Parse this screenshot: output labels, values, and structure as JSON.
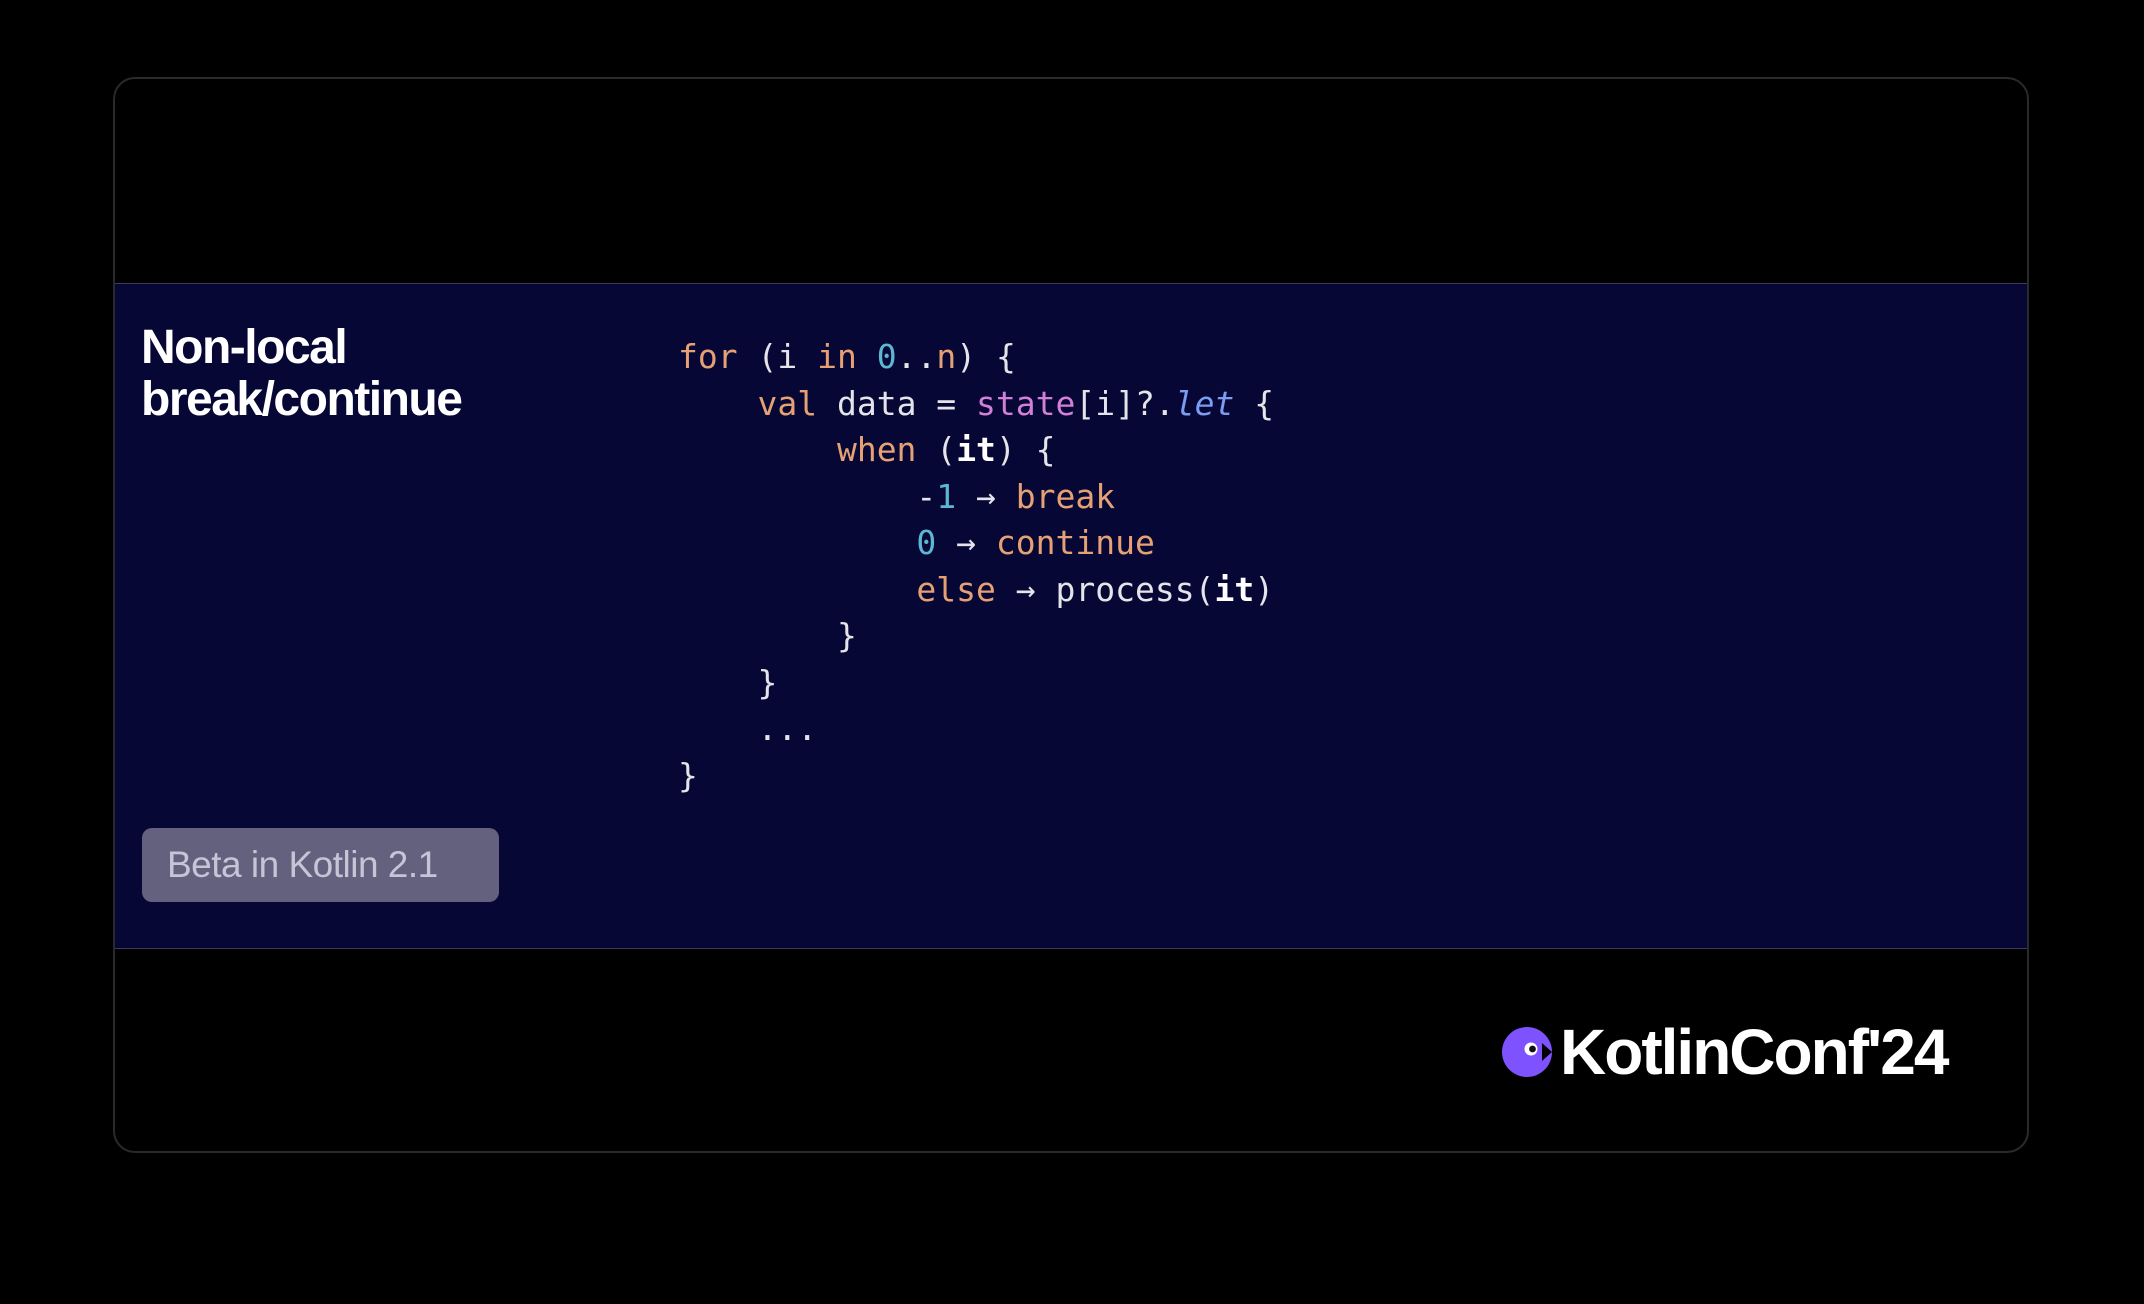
{
  "slide": {
    "title_lines": [
      "Non-local",
      "break/continue"
    ],
    "badge": "Beta in Kotlin 2.1",
    "brand": "KotlinConf'24",
    "brand_icon": "kotlinconf-logo-icon"
  },
  "code": [
    [
      {
        "t": "for",
        "c": "kw"
      },
      {
        "t": " (i "
      },
      {
        "t": "in",
        "c": "kw"
      },
      {
        "t": " "
      },
      {
        "t": "0",
        "c": "num"
      },
      {
        "t": ".."
      },
      {
        "t": "n",
        "c": "kw"
      },
      {
        "t": ") {"
      }
    ],
    [
      {
        "t": "    "
      },
      {
        "t": "val",
        "c": "kw"
      },
      {
        "t": " data = "
      },
      {
        "t": "state",
        "c": "fn"
      },
      {
        "t": "[i]?."
      },
      {
        "t": "let",
        "c": "it"
      },
      {
        "t": " {"
      }
    ],
    [
      {
        "t": "        "
      },
      {
        "t": "when",
        "c": "kw"
      },
      {
        "t": " ("
      },
      {
        "t": "it",
        "c": "bold"
      },
      {
        "t": ") {"
      }
    ],
    [
      {
        "t": "            "
      },
      {
        "t": "-"
      },
      {
        "t": "1",
        "c": "num"
      },
      {
        "t": " → "
      },
      {
        "t": "break",
        "c": "kw"
      }
    ],
    [
      {
        "t": "            "
      },
      {
        "t": "0",
        "c": "num"
      },
      {
        "t": " → "
      },
      {
        "t": "continue",
        "c": "kw"
      }
    ],
    [
      {
        "t": "            "
      },
      {
        "t": "else",
        "c": "kw"
      },
      {
        "t": " → process("
      },
      {
        "t": "it",
        "c": "bold"
      },
      {
        "t": ")"
      }
    ],
    [
      {
        "t": "        }"
      }
    ],
    [
      {
        "t": "    }"
      }
    ],
    [
      {
        "t": "    ..."
      }
    ],
    [
      {
        "t": "}"
      }
    ]
  ],
  "colors": {
    "band": "#070735",
    "keyword": "#e5a174",
    "number": "#5cb7d4",
    "function": "#d17fd8",
    "italic_fn": "#7b9cf0",
    "badge_bg": "#64617f",
    "logo_purple": "#7f52ff"
  }
}
